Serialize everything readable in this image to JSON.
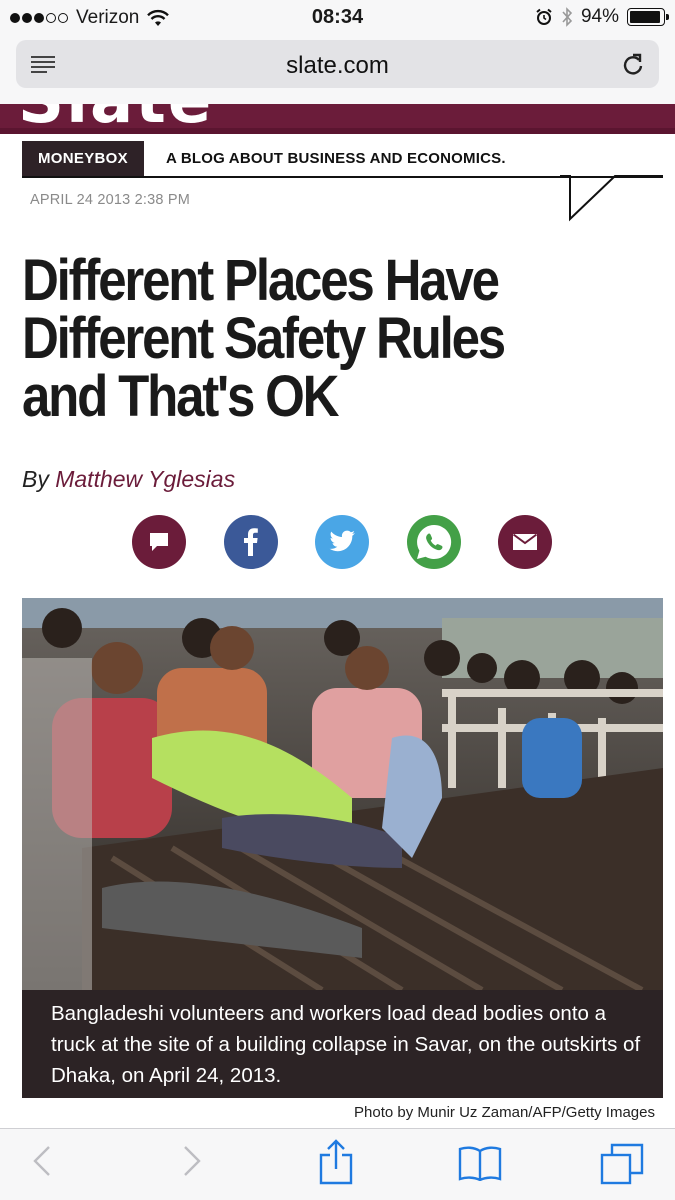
{
  "status_bar": {
    "carrier": "Verizon",
    "time": "08:34",
    "battery": "94%",
    "battery_level": 0.94,
    "signal_bars": 3,
    "signal_max": 5
  },
  "browser": {
    "url": "slate.com"
  },
  "section": {
    "name": "MONEYBOX",
    "description": "A BLOG ABOUT BUSINESS AND ECONOMICS."
  },
  "article": {
    "dateline": "APRIL 24 2013 2:38 PM",
    "headline": "Different Places Have Different Safety Rules and That's OK",
    "byline_prefix": "By",
    "author": "Matthew Yglesias",
    "caption": "Bangladeshi volunteers and workers load dead bodies onto a truck at the site of a building collapse in Savar, on the outskirts of Dhaka, on April 24, 2013.",
    "photo_credit": "Photo by Munir Uz Zaman/AFP/Getty Images"
  },
  "share_buttons": [
    {
      "icon": "comment-icon",
      "color": "#6b1c3a"
    },
    {
      "icon": "facebook-icon",
      "color": "#3b5998"
    },
    {
      "icon": "twitter-icon",
      "color": "#4aa6e6"
    },
    {
      "icon": "whatsapp-icon",
      "color": "#43a047"
    },
    {
      "icon": "email-icon",
      "color": "#6b1c3a"
    }
  ],
  "colors": {
    "brand": "#6b1c3a",
    "section_tag_bg": "#2e2227",
    "caption_bg": "#2c2325"
  }
}
